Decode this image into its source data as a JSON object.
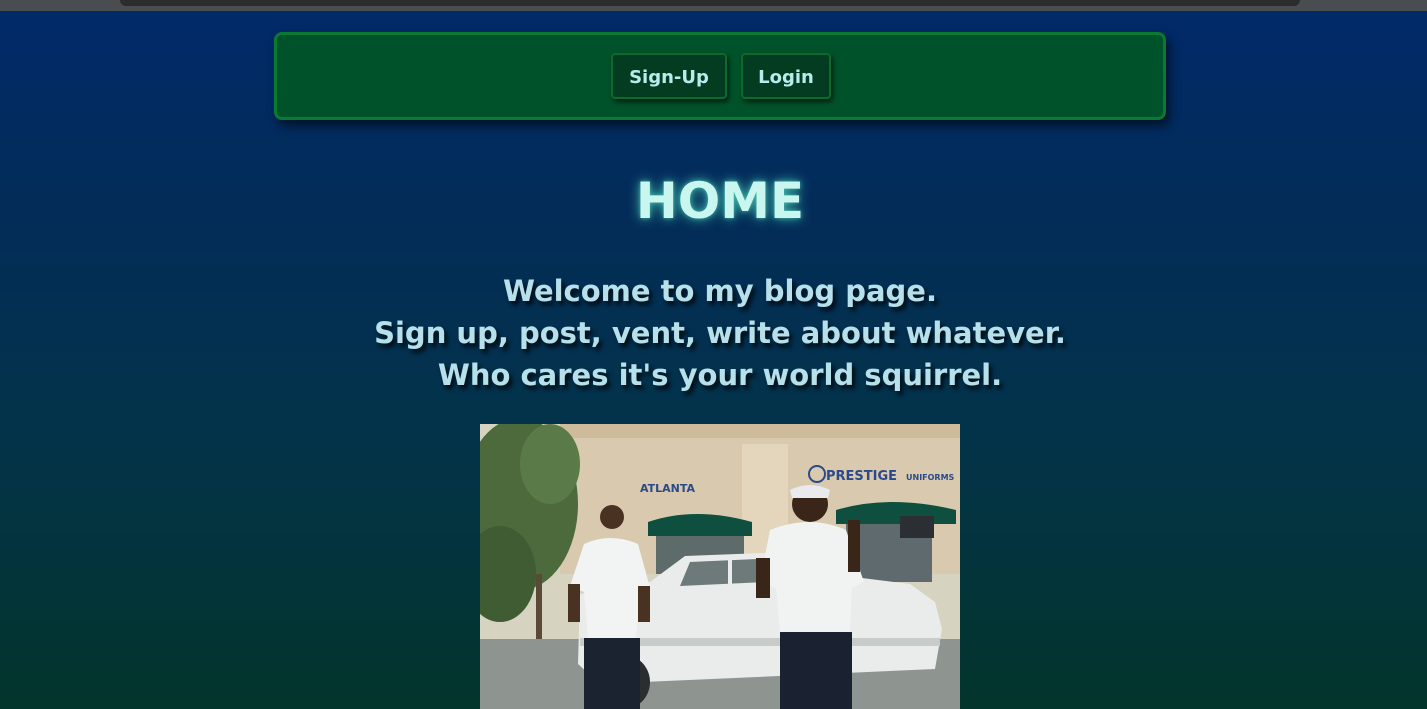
{
  "nav": {
    "signup_label": "Sign-Up",
    "login_label": "Login"
  },
  "page": {
    "title": "HOME",
    "welcome_lines": [
      "Welcome to my blog page.",
      "Sign up, post, vent, write about whatever.",
      "Who cares it's your world squirrel."
    ]
  },
  "photo": {
    "sign_left": "ATLANTA",
    "sign_right": "PRESTIGE",
    "sign_right_small": "UNIFORMS"
  },
  "colors": {
    "navbar": "#00522a",
    "button": "#033c21",
    "text": "#b6e0ea"
  }
}
